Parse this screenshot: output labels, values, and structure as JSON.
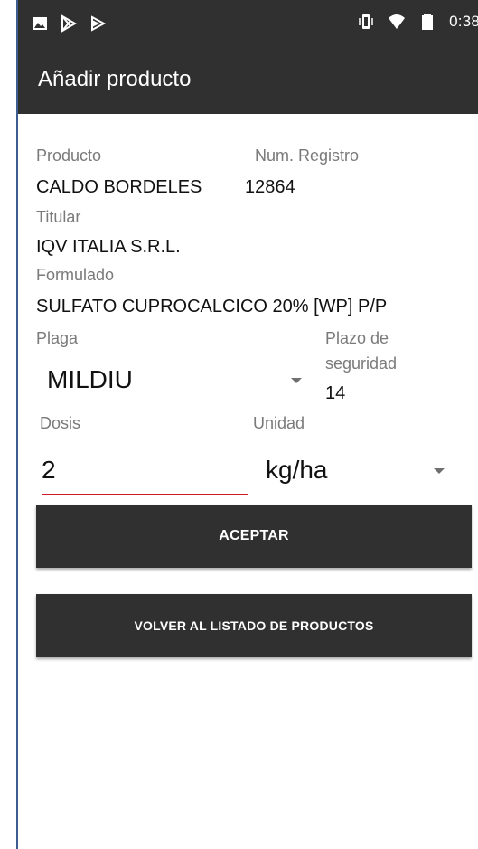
{
  "status_bar": {
    "time": "0:38",
    "left_icons": [
      "image-icon",
      "play-store-icon",
      "play-icon"
    ],
    "right_icons": [
      "vibrate-icon",
      "wifi-icon",
      "battery-icon"
    ]
  },
  "app_bar": {
    "title": "Añadir producto"
  },
  "product": {
    "producto_label": "Producto",
    "producto_value": "CALDO BORDELES",
    "registro_label": "Num. Registro",
    "registro_value": "12864",
    "titular_label": "Titular",
    "titular_value": "IQV ITALIA S.R.L.",
    "formulado_label": "Formulado",
    "formulado_value": "SULFATO CUPROCALCICO 20% [WP] P/P"
  },
  "plaga": {
    "label": "Plaga",
    "selected": "MILDIU"
  },
  "plazo": {
    "label_line1": "Plazo de",
    "label_line2": "seguridad",
    "value": "14"
  },
  "dosis": {
    "label": "Dosis",
    "value": "2"
  },
  "unidad": {
    "label": "Unidad",
    "selected": "kg/ha"
  },
  "buttons": {
    "accept": "ACEPTAR",
    "back": "VOLVER AL LISTADO DE PRODUCTOS"
  },
  "colors": {
    "bar": "#303030",
    "accent_underline": "#d11a2a",
    "label": "#7a7a7a"
  }
}
